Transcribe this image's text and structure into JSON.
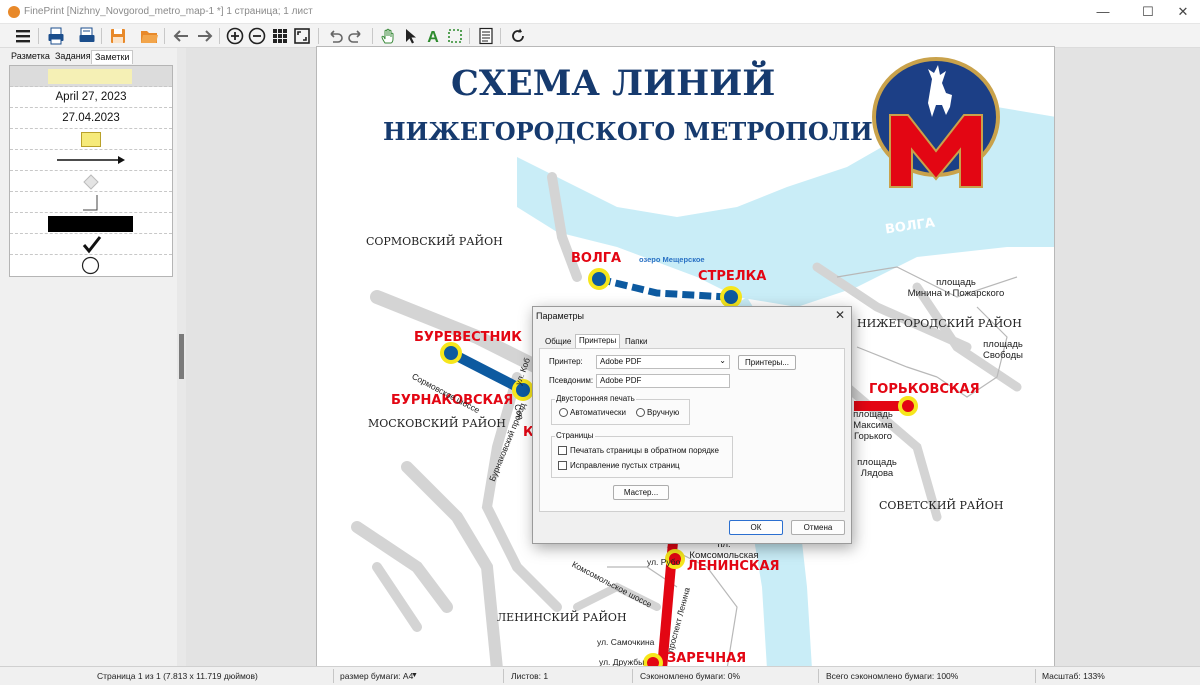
{
  "window": {
    "title": "FinePrint [Nizhny_Novgorod_metro_map-1 *] 1 страница; 1 лист",
    "controls": {
      "minimize": "—",
      "maximize": "☐",
      "close": "✕"
    }
  },
  "toolbar": {
    "icons": [
      "menu-icon",
      "print-icon",
      "printer-settings-icon",
      "save-icon",
      "open-folder-icon",
      "back-arrow-icon",
      "forward-arrow-icon",
      "zoom-in-icon",
      "zoom-out-icon",
      "grid-view-icon",
      "fit-page-icon",
      "undo-icon",
      "redo-icon",
      "hand-tool-icon",
      "select-arrow-icon",
      "text-tool-icon",
      "crop-tool-icon",
      "notes-icon",
      "refresh-icon"
    ]
  },
  "left_panel": {
    "tabs": [
      "Разметка",
      "Задания",
      "Заметки"
    ],
    "active_tab": "Заметки",
    "notes": {
      "date_long": "April 27, 2023",
      "date_short": "27.04.2023"
    }
  },
  "map": {
    "title_line1": "СХЕМА ЛИНИЙ",
    "title_line2": "НИЖЕГОРОДСКОГО МЕТРОПОЛИТЕНА",
    "river1": "ВОЛГА",
    "river2": "ВОЛГА",
    "lake": "озеро Мещерское",
    "districts": {
      "sormovsky": "СОРМОВСКИЙ РАЙОН",
      "moskovsky": "МОСКОВСКИЙ РАЙОН",
      "nizhegorodsky": "НИЖЕГОРОДСКИЙ РАЙОН",
      "sovetsky": "СОВЕТСКИЙ РАЙОН",
      "leninsky": "ЛЕНИНСКИЙ РАЙОН"
    },
    "stations": {
      "volga": "ВОЛГА",
      "strelka": "СТРЕЛКА",
      "burevestnik": "БУРЕВЕСТНИК",
      "burnakovskaya": "БУРНАКОВСКАЯ",
      "k_partial": "К",
      "gorkovskaya": "ГОРЬКОВСКАЯ",
      "leninskaya": "ЛЕНИНСКАЯ",
      "zarechnaya": "ЗАРЕЧНАЯ"
    },
    "places": {
      "minin_square": "площадь\nМинина и Пожарского",
      "freedom_square": "площадь\nСвободы",
      "gorky_square": "площадь\nМаксима\nГорького",
      "lyadov_square": "площадь\nЛядова",
      "komsomolskaya_sq": "пл.\nКомсомольская"
    },
    "streets": {
      "sormovskoe": "Сормовское шоссе",
      "burnakovsky": "Бурнаковский проезд",
      "kob": "ул. Коб",
      "sor": "Сор",
      "komsomolskoe": "Комсомольское шоссе",
      "rubo": "ул. Рубо",
      "lenina": "проспект Ленина",
      "samochkina": "ул. Самочкина",
      "druzhby": "ул. Дружбы"
    }
  },
  "dialog": {
    "title": "Параметры",
    "close": "✕",
    "tabs": [
      "Общие",
      "Принтеры",
      "Папки"
    ],
    "active_tab": "Принтеры",
    "printer_label": "Принтер:",
    "printer_value": "Adobe PDF",
    "printers_button": "Принтеры...",
    "alias_label": "Псевдоним:",
    "alias_value": "Adobe PDF",
    "duplex_group": "Двусторонняя печать",
    "duplex_auto": "Автоматически",
    "duplex_manual": "Вручную",
    "pages_group": "Страницы",
    "reverse_order": "Печатать страницы в обратном порядке",
    "fix_blank": "Исправление пустых страниц",
    "wizard_button": "Мастер...",
    "ok_button": "ОК",
    "cancel_button": "Отмена"
  },
  "status": {
    "page": "Страница 1 из 1 (7.813 x 11.719 дюймов)",
    "paper": "размер бумаги: A4",
    "sheets": "Листов: 1",
    "saved": "Сэкономлено бумаги: 0%",
    "total_saved": "Всего сэкономлено бумаги: 100%",
    "zoom": "Масштаб: 133%"
  },
  "colors": {
    "title_blue": "#163a6e",
    "line_red": "#e30613",
    "line_blue": "#0d5aa0",
    "station_yellow": "#f6e61c",
    "river": "#c9edf7",
    "roads": "#d4d4d4"
  }
}
